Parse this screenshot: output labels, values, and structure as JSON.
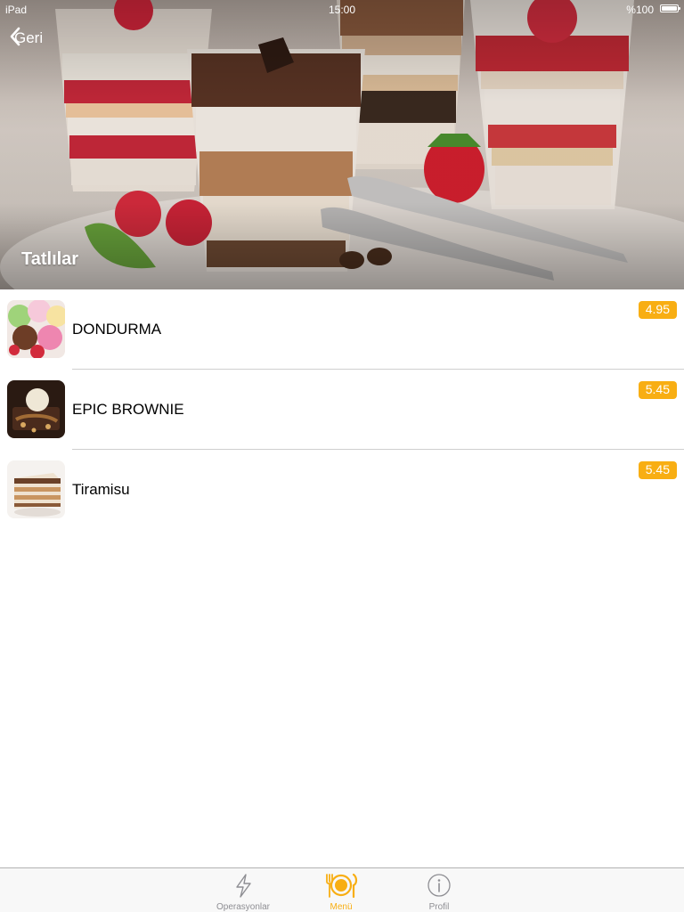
{
  "status_bar": {
    "carrier": "iPad",
    "time": "15:00",
    "battery": "%100"
  },
  "nav": {
    "back_label": "Geri"
  },
  "header": {
    "title": "Tatlılar"
  },
  "items": [
    {
      "name": "DONDURMA",
      "price": "4.95",
      "image": "ice-cream-scoops"
    },
    {
      "name": "EPIC BROWNIE",
      "price": "5.45",
      "image": "brownie-with-ice-cream"
    },
    {
      "name": "Tiramisu",
      "price": "5.45",
      "image": "tiramisu-slice"
    }
  ],
  "tabs": [
    {
      "label": "Operasyonlar",
      "icon": "lightning-icon",
      "active": false
    },
    {
      "label": "Menü",
      "icon": "fork-plate-knife-icon",
      "active": true
    },
    {
      "label": "Profil",
      "icon": "info-circle-icon",
      "active": false
    }
  ],
  "colors": {
    "accent": "#f8ae13",
    "separator": "#cfcfcf",
    "tab_inactive": "#8e8e93"
  }
}
